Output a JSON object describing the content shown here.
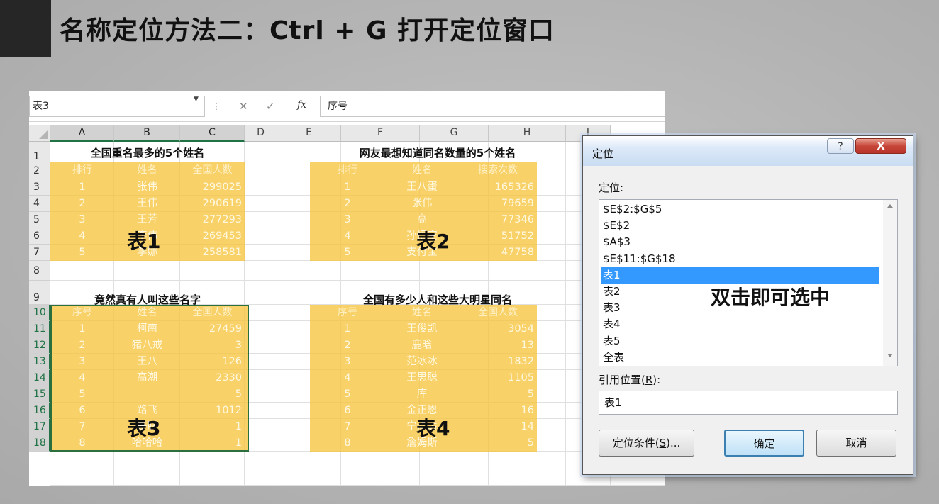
{
  "slide": {
    "title": "名称定位方法二：Ctrl + G 打开定位窗口"
  },
  "excel": {
    "name_box": "表3",
    "formula_value": "序号",
    "fx": "fx",
    "columns": [
      "A",
      "B",
      "C",
      "D",
      "E",
      "F",
      "G",
      "H",
      "I"
    ],
    "rows": [
      "1",
      "2",
      "3",
      "4",
      "5",
      "6",
      "7",
      "8",
      "9",
      "10",
      "11",
      "12",
      "13",
      "14",
      "15",
      "16",
      "17",
      "18"
    ],
    "selected_rows": [
      "10",
      "11",
      "12",
      "13",
      "14",
      "15",
      "16",
      "17",
      "18"
    ],
    "tables": [
      {
        "title": "全国重名最多的5个姓名",
        "headers": [
          "排行",
          "姓名",
          "全国人数"
        ],
        "rows": [
          [
            "1",
            "张伟",
            "299025"
          ],
          [
            "2",
            "王伟",
            "290619"
          ],
          [
            "3",
            "王芳",
            "277293"
          ],
          [
            "4",
            "李伟",
            "269453"
          ],
          [
            "5",
            "李娜",
            "258581"
          ]
        ],
        "label": "表1"
      },
      {
        "title": "网友最想知道同名数量的5个姓名",
        "headers": [
          "排行",
          "姓名",
          "搜索次数"
        ],
        "rows": [
          [
            "1",
            "王八蛋",
            "165326"
          ],
          [
            "2",
            "张伟",
            "79659"
          ],
          [
            "3",
            "高",
            "77346"
          ],
          [
            "4",
            "孙悟空",
            "51752"
          ],
          [
            "5",
            "支付宝",
            "47758"
          ]
        ],
        "label": "表2"
      },
      {
        "title": "竟然真有人叫这些名字",
        "headers": [
          "序号",
          "姓名",
          "全国人数"
        ],
        "rows": [
          [
            "1",
            "柯南",
            "27459"
          ],
          [
            "2",
            "猪八戒",
            "3"
          ],
          [
            "3",
            "王八",
            "126"
          ],
          [
            "4",
            "高潮",
            "2330"
          ],
          [
            "5",
            "",
            "5"
          ],
          [
            "6",
            "路飞",
            "1012"
          ],
          [
            "7",
            "是朕",
            "1"
          ],
          [
            "8",
            "哈哈哈",
            "1"
          ]
        ],
        "label": "表3"
      },
      {
        "title": "全国有多少人和这些大明星同名",
        "headers": [
          "序号",
          "姓名",
          "全国人数"
        ],
        "rows": [
          [
            "1",
            "王俊凯",
            "3054"
          ],
          [
            "2",
            "鹿晗",
            "13"
          ],
          [
            "3",
            "范冰冰",
            "1832"
          ],
          [
            "4",
            "王思聪",
            "1105"
          ],
          [
            "5",
            "库",
            "5"
          ],
          [
            "6",
            "金正恩",
            "16"
          ],
          [
            "7",
            "宁泽涛",
            "14"
          ],
          [
            "8",
            "詹姆斯",
            "5"
          ]
        ],
        "label": "表4"
      }
    ]
  },
  "dialog": {
    "title": "定位",
    "help": "?",
    "close": "X",
    "goto_label": "定位:",
    "items": [
      "$E$2:$G$5",
      "$E$2",
      "$A$3",
      "$E$11:$G$18",
      "表1",
      "表2",
      "表3",
      "表4",
      "表5",
      "全表"
    ],
    "selected_item": "表1",
    "hint": "双击即可选中",
    "reference_label_prefix": "引用位置(",
    "reference_label_key": "R",
    "reference_label_suffix": "):",
    "reference_value": "表1",
    "special_prefix": "定位条件(",
    "special_key": "S",
    "special_suffix": ")...",
    "ok": "确定",
    "cancel": "取消"
  }
}
